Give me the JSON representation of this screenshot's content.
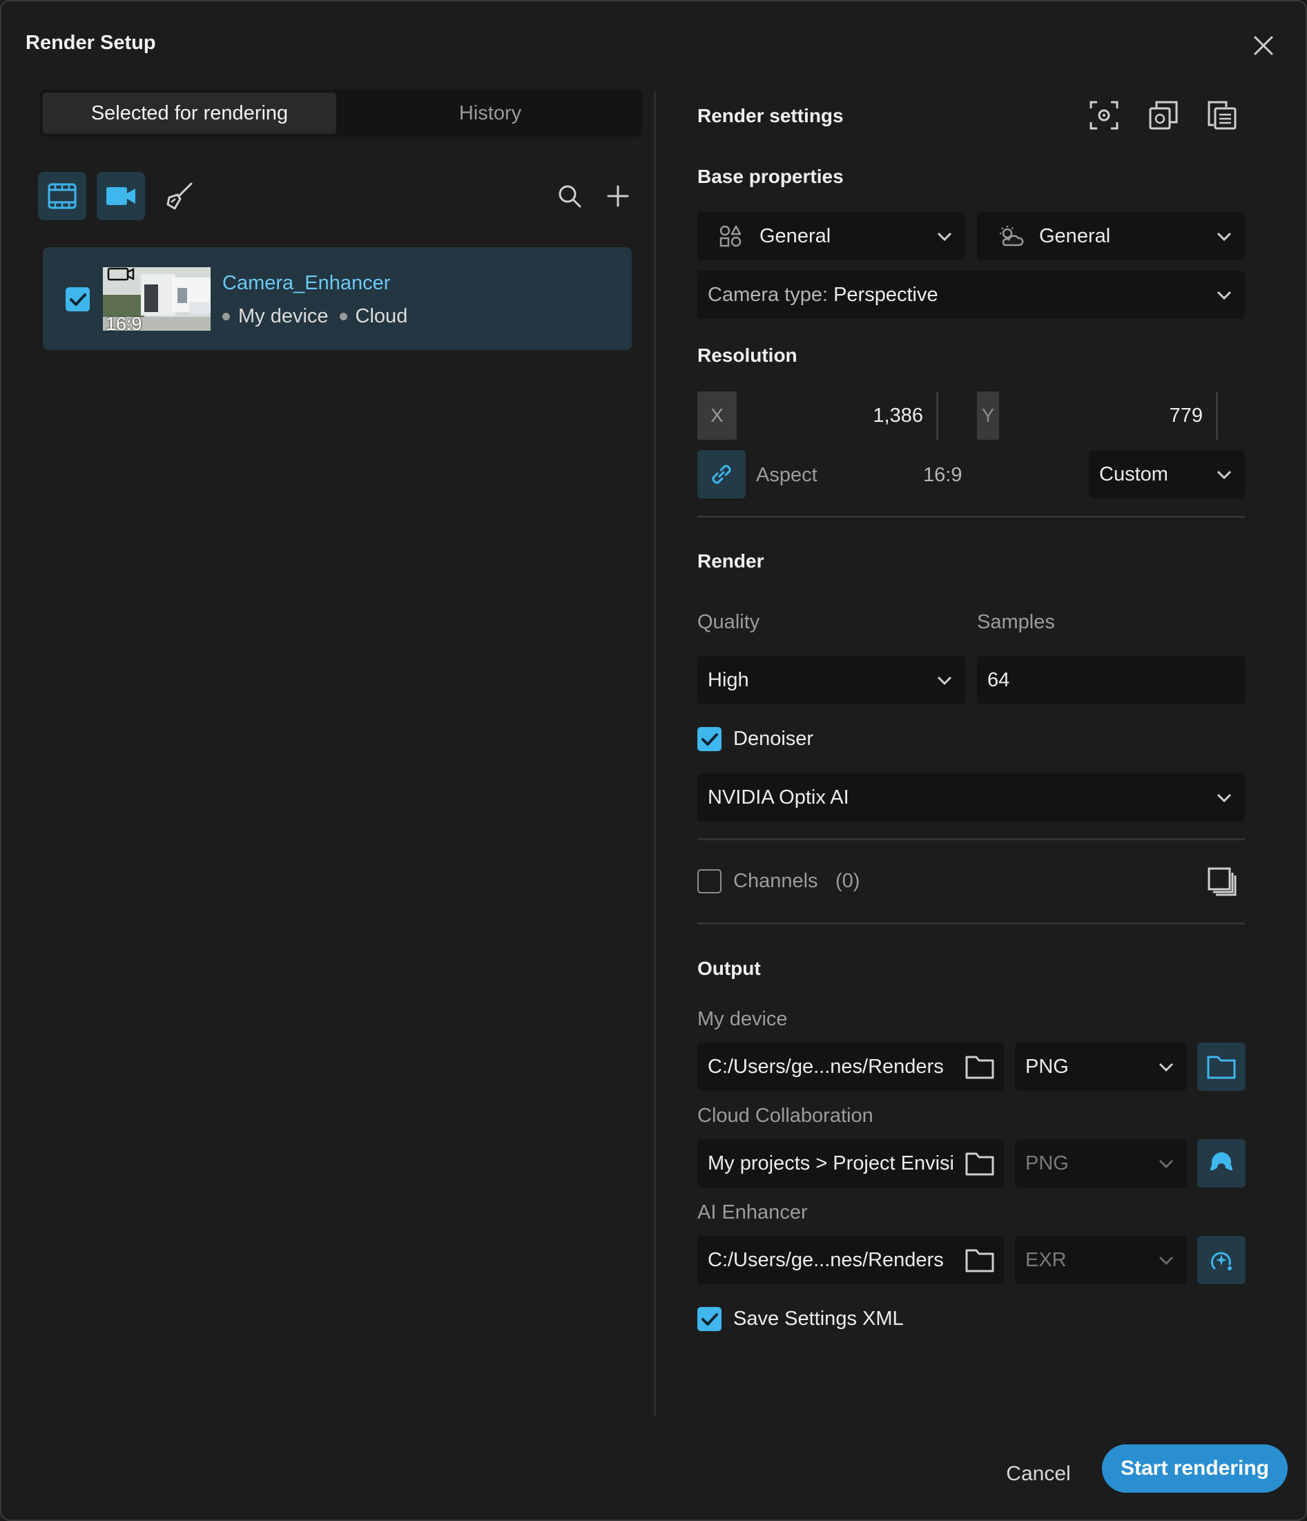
{
  "window": {
    "title": "Render Setup"
  },
  "tabs": {
    "selected": "Selected for rendering",
    "history": "History"
  },
  "item": {
    "name": "Camera_Enhancer",
    "aspect": "16:9",
    "tag1": "My device",
    "tag2": "Cloud",
    "checked": true
  },
  "settings": {
    "title": "Render settings",
    "base": {
      "title": "Base properties",
      "dropdown1": "General",
      "dropdown2": "General",
      "camera_label": "Camera type:",
      "camera_value": "Perspective"
    },
    "resolution": {
      "title": "Resolution",
      "x_label": "X",
      "x_value": "1,386",
      "y_label": "Y",
      "y_value": "779",
      "aspect_label": "Aspect",
      "aspect_value": "16:9",
      "preset": "Custom"
    },
    "render": {
      "title": "Render",
      "quality_label": "Quality",
      "quality_value": "High",
      "samples_label": "Samples",
      "samples_value": "64",
      "denoiser_label": "Denoiser",
      "denoiser_value": "NVIDIA Optix AI"
    },
    "channels": {
      "label": "Channels",
      "count": "(0)"
    },
    "output": {
      "title": "Output",
      "device_label": "My device",
      "device_path": "C:/Users/ge...nes/Renders",
      "device_format": "PNG",
      "cloud_label": "Cloud Collaboration",
      "cloud_path": "My projects > Project Envisi",
      "cloud_format": "PNG",
      "ai_label": "AI Enhancer",
      "ai_path": "C:/Users/ge...nes/Renders",
      "ai_format": "EXR",
      "save_xml_label": "Save Settings XML"
    }
  },
  "footer": {
    "cancel": "Cancel",
    "start": "Start rendering"
  },
  "colors": {
    "accent": "#3fb6ec",
    "primary_button": "#2a8fd1",
    "selected_bg": "#233641"
  }
}
